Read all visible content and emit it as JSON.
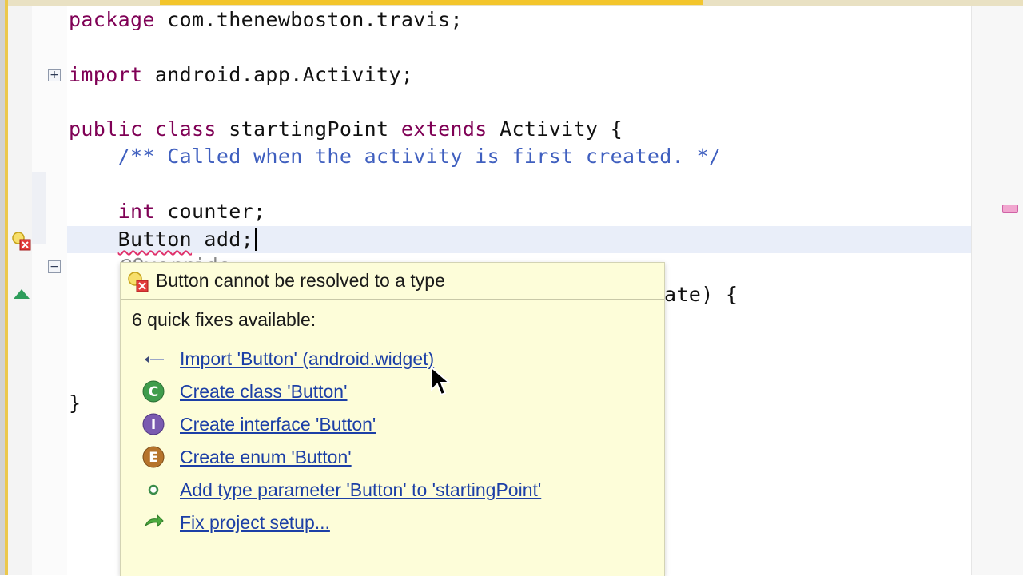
{
  "editor": {
    "lines": {
      "package_kw": "package",
      "package_rest": " com.thenewboston.travis;",
      "import_kw": "import",
      "import_rest": " android.app.Activity;",
      "class_public": "public",
      "class_class": "class",
      "class_name": " startingPoint ",
      "class_extends": "extends",
      "class_rest": " Activity {",
      "comment": "    /** Called when the activity is first created. */",
      "int_kw": "int",
      "int_rest": " counter;",
      "button_type": "Button",
      "button_rest": " add;",
      "partial_annotation": "@Override",
      "partial_method": "ate) {",
      "closing_brace": "}"
    },
    "fold_expand_symbol": "+",
    "fold_collapse_symbol": "−"
  },
  "quickfix": {
    "header": "Button cannot be resolved to a type",
    "count_label": "6 quick fixes available:",
    "items": [
      {
        "label": "Import 'Button' (android.widget)",
        "icon": "import-arrow-icon"
      },
      {
        "label": "Create class 'Button'",
        "icon": "class-c-icon"
      },
      {
        "label": "Create interface 'Button'",
        "icon": "interface-i-icon"
      },
      {
        "label": "Create enum 'Button'",
        "icon": "enum-e-icon"
      },
      {
        "label": "Add type parameter 'Button' to 'startingPoint'",
        "icon": "type-parameter-icon"
      },
      {
        "label": "Fix project setup...",
        "icon": "fix-setup-icon"
      }
    ]
  },
  "colors": {
    "keyword": "#7f0055",
    "comment": "#3f5fbf",
    "link": "#1c3fa6",
    "popup_background": "#fdfdd9",
    "error_underline": "#e0306a",
    "current_line": "#e9eef9"
  }
}
